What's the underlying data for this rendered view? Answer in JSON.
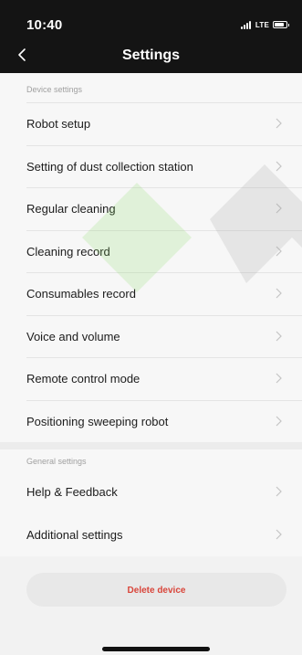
{
  "status_bar": {
    "time": "10:40",
    "network": "LTE",
    "battery_level": 0.85
  },
  "header": {
    "title": "Settings",
    "back_icon": "chevron-left-icon"
  },
  "sections": [
    {
      "label": "Device settings",
      "items": [
        {
          "label": "Robot setup"
        },
        {
          "label": "Setting of dust collection station"
        },
        {
          "label": "Regular cleaning"
        },
        {
          "label": "Cleaning record"
        },
        {
          "label": "Consumables record"
        },
        {
          "label": "Voice and volume"
        },
        {
          "label": "Remote control mode"
        },
        {
          "label": "Positioning sweeping robot"
        }
      ]
    },
    {
      "label": "General settings",
      "items": [
        {
          "label": "Help & Feedback"
        },
        {
          "label": "Additional settings"
        }
      ]
    }
  ],
  "actions": {
    "delete_label": "Delete device"
  },
  "colors": {
    "header_bg": "#141414",
    "delete_text": "#d9453a",
    "chevron": "#c4c4c4"
  }
}
